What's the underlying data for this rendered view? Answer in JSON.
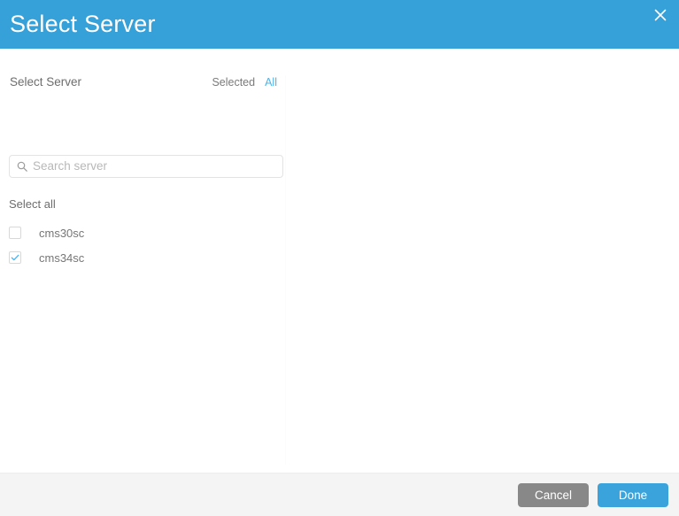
{
  "dialog": {
    "title": "Select Server",
    "close_icon": "close-icon"
  },
  "panel": {
    "label": "Select Server",
    "filters": [
      {
        "label": "Selected",
        "active": false
      },
      {
        "label": "All",
        "active": true
      }
    ],
    "search": {
      "icon": "search-icon",
      "placeholder": "Search server",
      "value": ""
    },
    "select_all_label": "Select all",
    "servers": [
      {
        "name": "cms30sc",
        "checked": false
      },
      {
        "name": "cms34sc",
        "checked": true
      }
    ]
  },
  "footer": {
    "cancel_label": "Cancel",
    "done_label": "Done"
  },
  "colors": {
    "header_blue": "#36a0d8",
    "accent_blue": "#4db3e8",
    "done_blue": "#3aa3db",
    "cancel_gray": "#888888",
    "footer_bg": "#f4f4f4",
    "text_gray": "#6d6d6d"
  }
}
